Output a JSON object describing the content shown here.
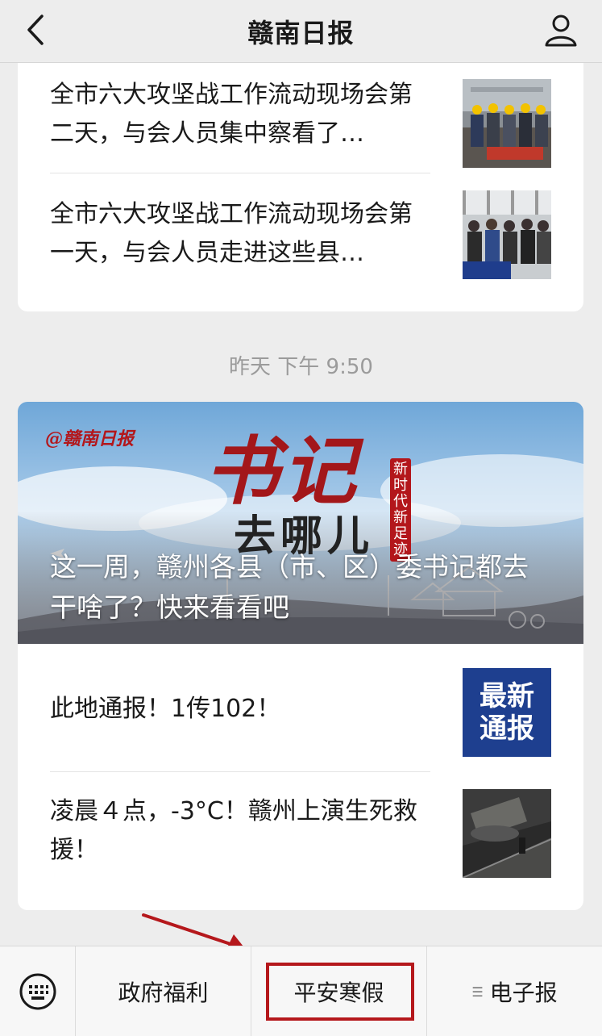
{
  "header": {
    "title": "赣南日报"
  },
  "card1": {
    "articles": [
      {
        "title": "全市六大攻坚战工作流动现场会第二天，与会人员集中察看了…"
      },
      {
        "title": "全市六大攻坚战工作流动现场会第一天，与会人员走进这些县…"
      }
    ]
  },
  "timestamp": "昨天 下午 9:50",
  "card2": {
    "banner": {
      "logo": "@赣南日报",
      "art_title": "书记",
      "art_subtitle": "去哪儿",
      "art_tag": "新时代新足迹",
      "headline": "这一周，赣州各县（市、区）委书记都去干啥了？快来看看吧"
    },
    "articles": [
      {
        "title": "此地通报！1传102！",
        "thumb_text": "最新通报"
      },
      {
        "title": "凌晨４点，-3°C！赣州上演生死救援！"
      }
    ]
  },
  "menu": {
    "items": [
      {
        "label": "政府福利"
      },
      {
        "label": "平安寒假"
      },
      {
        "label": "电子报"
      }
    ]
  },
  "colors": {
    "highlight": "#b5181c",
    "background": "#ededed",
    "thumb_blue": "#1e3f8f"
  }
}
